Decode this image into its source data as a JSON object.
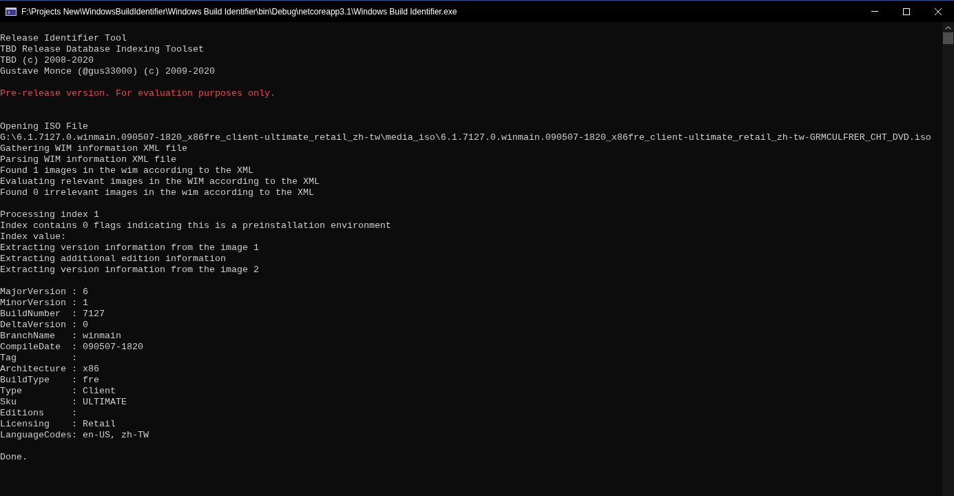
{
  "window": {
    "title": "F:\\Projects New\\WindowsBuildIdentifier\\Windows Build Identifier\\bin\\Debug\\netcoreapp3.1\\Windows Build Identifier.exe"
  },
  "console": {
    "blocks": [
      {
        "kind": "paragraph",
        "lines": [
          {
            "kind": "normal",
            "text": "Release Identifier Tool"
          },
          {
            "kind": "normal",
            "text": "TBD Release Database Indexing Toolset"
          },
          {
            "kind": "normal",
            "text": "TBD (c) 2008-2020"
          },
          {
            "kind": "normal",
            "text": "Gustave Monce (@gus33000) (c) 2009-2020"
          }
        ]
      },
      {
        "kind": "section",
        "lines": [
          {
            "kind": "warning",
            "text": "Pre-release version. For evaluation purposes only."
          }
        ]
      },
      {
        "kind": "paragraph",
        "lines": [
          {
            "kind": "normal",
            "text": "Opening ISO File"
          },
          {
            "kind": "normal",
            "text": "G:\\6.1.7127.0.winmain.090507-1820_x86fre_client-ultimate_retail_zh-tw\\media_iso\\6.1.7127.0.winmain.090507-1820_x86fre_client-ultimate_retail_zh-tw-GRMCULFRER_CHT_DVD.iso"
          },
          {
            "kind": "normal",
            "text": "Gathering WIM information XML file"
          },
          {
            "kind": "normal",
            "text": "Parsing WIM information XML file"
          },
          {
            "kind": "normal",
            "text": "Found 1 images in the wim according to the XML"
          },
          {
            "kind": "normal",
            "text": "Evaluating relevant images in the WIM according to the XML"
          },
          {
            "kind": "normal",
            "text": "Found 0 irrelevant images in the wim according to the XML"
          }
        ]
      },
      {
        "kind": "paragraph",
        "lines": [
          {
            "kind": "normal",
            "text": "Processing index 1"
          },
          {
            "kind": "normal",
            "text": "Index contains 0 flags indicating this is a preinstallation environment"
          },
          {
            "kind": "normal",
            "text": "Index value:"
          },
          {
            "kind": "normal",
            "text": "Extracting version information from the image 1"
          },
          {
            "kind": "normal",
            "text": "Extracting additional edition information"
          },
          {
            "kind": "normal",
            "text": "Extracting version information from the image 2"
          }
        ]
      },
      {
        "kind": "paragraph",
        "lines": [
          {
            "kind": "normal",
            "text": "MajorVersion : 6"
          },
          {
            "kind": "normal",
            "text": "MinorVersion : 1"
          },
          {
            "kind": "normal",
            "text": "BuildNumber  : 7127"
          },
          {
            "kind": "normal",
            "text": "DeltaVersion : 0"
          },
          {
            "kind": "normal",
            "text": "BranchName   : winmain"
          },
          {
            "kind": "normal",
            "text": "CompileDate  : 090507-1820"
          },
          {
            "kind": "normal",
            "text": "Tag          :"
          },
          {
            "kind": "normal",
            "text": "Architecture : x86"
          },
          {
            "kind": "normal",
            "text": "BuildType    : fre"
          },
          {
            "kind": "normal",
            "text": "Type         : Client"
          },
          {
            "kind": "normal",
            "text": "Sku          : ULTIMATE"
          },
          {
            "kind": "normal",
            "text": "Editions     :"
          },
          {
            "kind": "normal",
            "text": "Licensing    : Retail"
          },
          {
            "kind": "normal",
            "text": "LanguageCodes: en-US, zh-TW"
          }
        ]
      },
      {
        "kind": "paragraph",
        "lines": [
          {
            "kind": "normal",
            "text": "Done."
          }
        ]
      }
    ]
  }
}
